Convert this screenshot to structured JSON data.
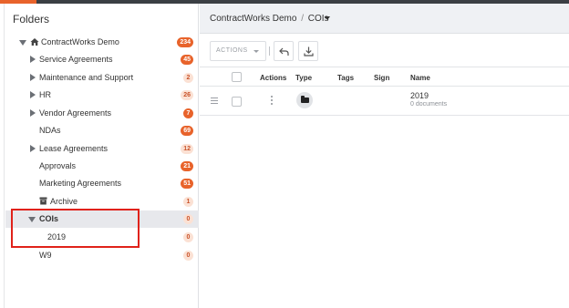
{
  "sidebar": {
    "title": "Folders",
    "items": [
      {
        "label": "ContractWorks Demo",
        "count": "234"
      },
      {
        "label": "Service Agreements",
        "count": "45"
      },
      {
        "label": "Maintenance and Support",
        "count": "2"
      },
      {
        "label": "HR",
        "count": "26"
      },
      {
        "label": "Vendor Agreements",
        "count": "7"
      },
      {
        "label": "NDAs",
        "count": "69"
      },
      {
        "label": "Lease Agreements",
        "count": "12"
      },
      {
        "label": "Approvals",
        "count": "21"
      },
      {
        "label": "Marketing Agreements",
        "count": "51"
      },
      {
        "label": "Archive",
        "count": "1"
      },
      {
        "label": "COIs",
        "count": "0"
      },
      {
        "label": "2019",
        "count": "0"
      },
      {
        "label": "W9",
        "count": "0"
      }
    ]
  },
  "breadcrumb": {
    "root": "ContractWorks Demo",
    "separator": "/",
    "current": "COIs"
  },
  "toolbar": {
    "actions_label": "ACTIONS"
  },
  "table": {
    "columns": [
      "Actions",
      "Type",
      "Tags",
      "Sign",
      "Name"
    ],
    "rows": [
      {
        "name": "2019",
        "subtitle": "0 documents",
        "type_icon": "folder-icon"
      }
    ]
  },
  "colors": {
    "accent": "#e8632b",
    "badge_light": "#fbe1d4",
    "highlight_outline": "#e0221a",
    "selected_row": "#e7e8ec"
  }
}
